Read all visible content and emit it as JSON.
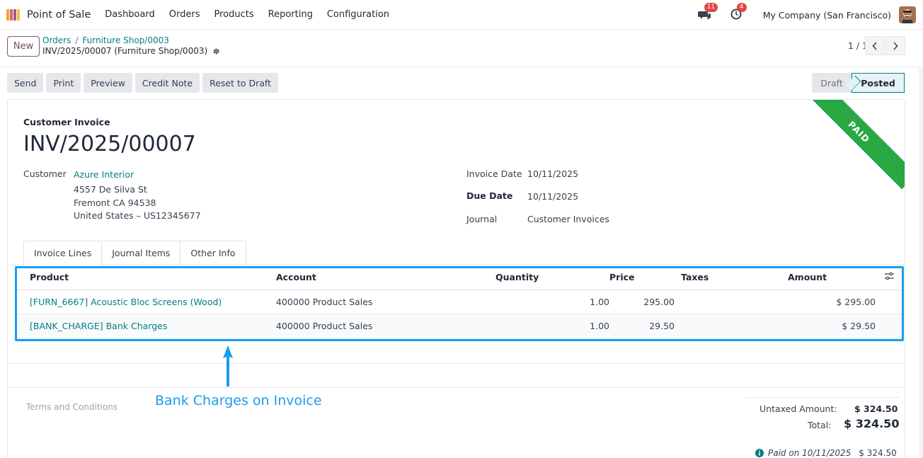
{
  "navbar": {
    "app_name": "Point of Sale",
    "menu": [
      "Dashboard",
      "Orders",
      "Products",
      "Reporting",
      "Configuration"
    ],
    "messages_count": "11",
    "activities_count": "4",
    "company": "My Company (San Francisco)"
  },
  "control": {
    "new_label": "New",
    "breadcrumb": [
      "Orders",
      "Furniture Shop/0003"
    ],
    "record_name": "INV/2025/00007 (Furniture Shop/0003)",
    "pager": "1 / 1"
  },
  "actions": [
    "Send",
    "Print",
    "Preview",
    "Credit Note",
    "Reset to Draft"
  ],
  "status": {
    "draft": "Draft",
    "posted": "Posted"
  },
  "ribbon": "PAID",
  "invoice": {
    "type": "Customer Invoice",
    "name": "INV/2025/00007",
    "customer_label": "Customer",
    "customer_name": "Azure Interior",
    "address": [
      "4557 De Silva St",
      "Fremont CA 94538",
      "United States – US12345677"
    ],
    "invoice_date_label": "Invoice Date",
    "invoice_date": "10/11/2025",
    "due_date_label": "Due Date",
    "due_date": "10/11/2025",
    "journal_label": "Journal",
    "journal": "Customer Invoices"
  },
  "tabs": [
    "Invoice Lines",
    "Journal Items",
    "Other Info"
  ],
  "lines": {
    "headers": {
      "product": "Product",
      "account": "Account",
      "quantity": "Quantity",
      "price": "Price",
      "taxes": "Taxes",
      "amount": "Amount"
    },
    "rows": [
      {
        "product": "[FURN_6667] Acoustic Bloc Screens (Wood)",
        "account": "400000 Product Sales",
        "quantity": "1.00",
        "price": "295.00",
        "taxes": "",
        "amount": "$ 295.00"
      },
      {
        "product": "[BANK_CHARGE] Bank Charges",
        "account": "400000 Product Sales",
        "quantity": "1.00",
        "price": "29.50",
        "taxes": "",
        "amount": "$ 29.50"
      }
    ]
  },
  "terms_placeholder": "Terms and Conditions",
  "annotation": "Bank Charges on Invoice",
  "totals": {
    "untaxed_label": "Untaxed Amount:",
    "untaxed_value": "$ 324.50",
    "total_label": "Total:",
    "total_value": "$ 324.50",
    "paid_text": "Paid on 10/11/2025",
    "paid_value": "$ 324.50"
  },
  "colors": {
    "accent": "#017e84",
    "brand": "#714b67",
    "paid_ribbon": "#28a745",
    "annotation": "#1b9cee"
  }
}
